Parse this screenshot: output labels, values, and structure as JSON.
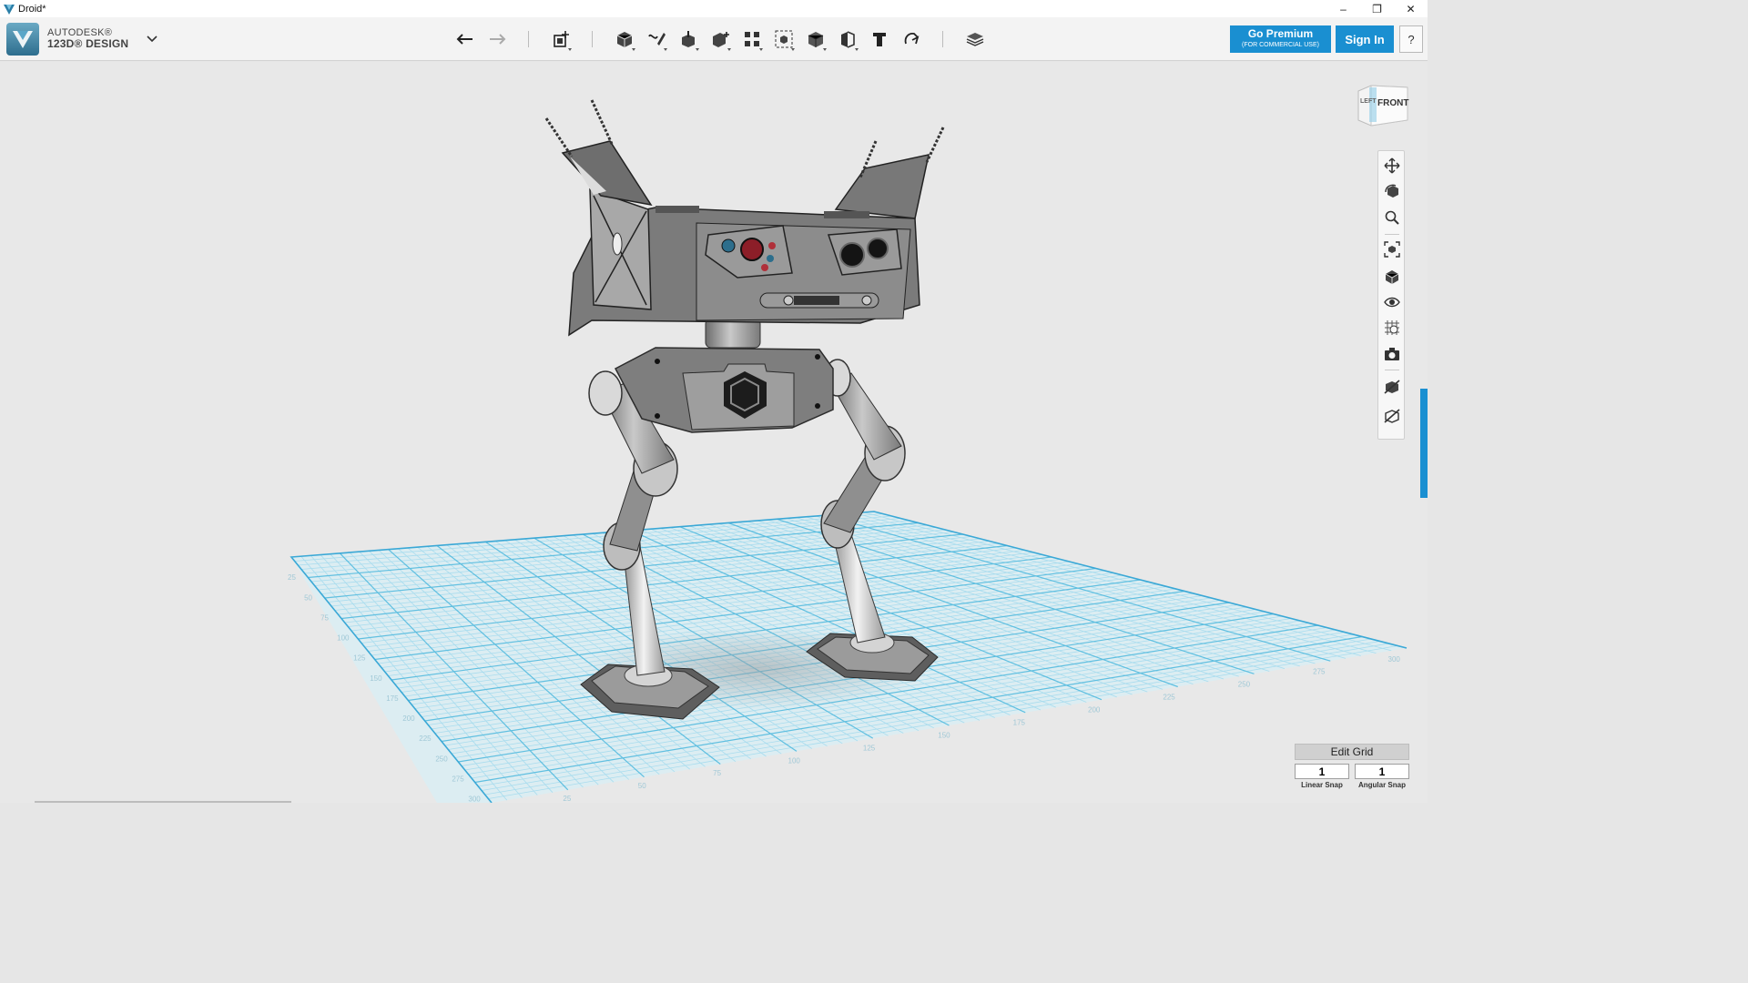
{
  "window": {
    "title": "Droid*",
    "controls": {
      "minimize": "–",
      "restore": "❐",
      "close": "✕"
    }
  },
  "brand": {
    "line1": "AUTODESK®",
    "line2": "123D® DESIGN"
  },
  "toolbar": {
    "icons": [
      "undo-icon",
      "redo-icon",
      "transform-icon",
      "primitives-icon",
      "sketch-icon",
      "construct-icon",
      "modify-icon",
      "pattern-icon",
      "group-icon",
      "combine-icon",
      "measure-icon",
      "text-icon",
      "snap-icon",
      "material-icon"
    ]
  },
  "actions": {
    "premium_label": "Go Premium",
    "premium_sublabel": "(FOR COMMERCIAL USE)",
    "signin_label": "Sign In",
    "help_label": "?"
  },
  "viewcube": {
    "front_label": "FRONT",
    "side_label": "LEFT"
  },
  "navigation": {
    "icons": [
      "pan-icon",
      "orbit-icon",
      "zoom-icon",
      "fit-icon",
      "views-icon",
      "visibility-icon",
      "grid-visibility-icon",
      "camera-icon",
      "materials-icon",
      "outline-icon"
    ]
  },
  "grid": {
    "edit_label": "Edit Grid",
    "linear_snap_value": "1",
    "angular_snap_value": "1",
    "linear_snap_label": "Linear Snap",
    "angular_snap_label": "Angular Snap",
    "left_axis_ticks": [
      "25",
      "50",
      "75",
      "100",
      "125",
      "150",
      "175",
      "200",
      "225",
      "250",
      "275",
      "300"
    ],
    "bottom_axis_ticks": [
      "25",
      "50",
      "75",
      "100",
      "125",
      "150",
      "175",
      "200",
      "225",
      "250",
      "275",
      "300"
    ]
  },
  "colors": {
    "accent": "#1a8fd1",
    "grid_line": "#8fd0e5",
    "grid_fill": "#dcedf2",
    "model_body": "#8a8a8a"
  }
}
